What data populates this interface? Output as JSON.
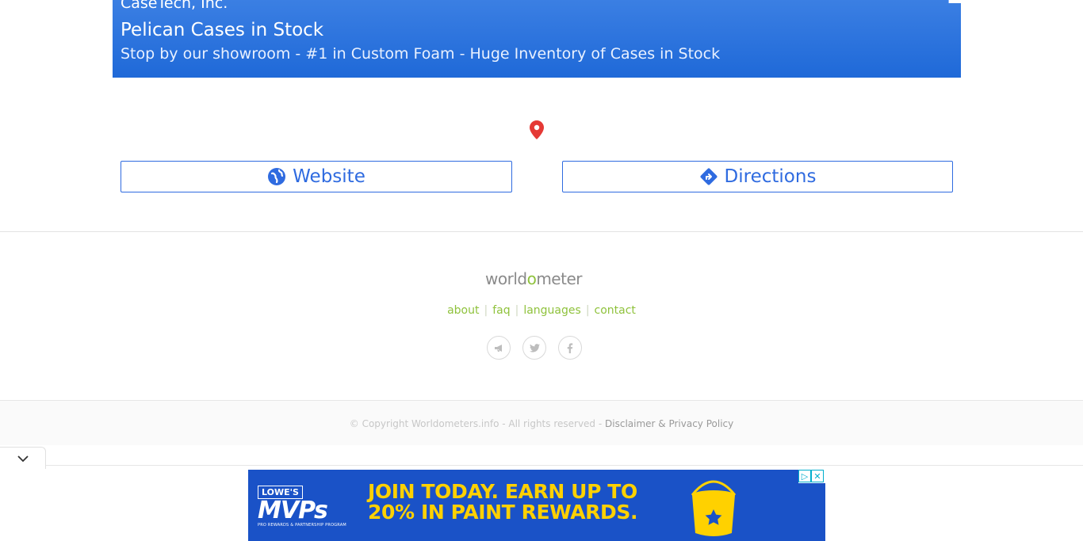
{
  "top_ad": {
    "advertiser": "CaseTech, Inc.",
    "headline": "Pelican Cases in Stock",
    "description": "Stop by our showroom - #1 in Custom Foam - Huge Inventory of Cases in Stock"
  },
  "actions": {
    "website_label": "Website",
    "directions_label": "Directions"
  },
  "footer": {
    "logo_prefix": "world",
    "logo_o": "o",
    "logo_suffix": "meter",
    "links": [
      "about",
      "faq",
      "languages",
      "contact"
    ],
    "social_icons": [
      "megaphone-icon",
      "twitter-icon",
      "facebook-icon"
    ],
    "copyright": "© Copyright Worldometers.info - All rights reserved - ",
    "disclaimer_link": "Disclaimer & Privacy Policy"
  },
  "bottom_ad": {
    "brand": "LOWE'S",
    "program": "MVPs",
    "program_sub": "PRO REWARDS & PARTNERSHIP PROGRAM",
    "line1": "JOIN TODAY. EARN UP TO",
    "line2": "20% IN PAINT REWARDS."
  },
  "colors": {
    "ad_blue": "#1f69d8",
    "link_green": "#8fc23c",
    "button_blue": "#2f6be0",
    "pin_red": "#e53935"
  }
}
